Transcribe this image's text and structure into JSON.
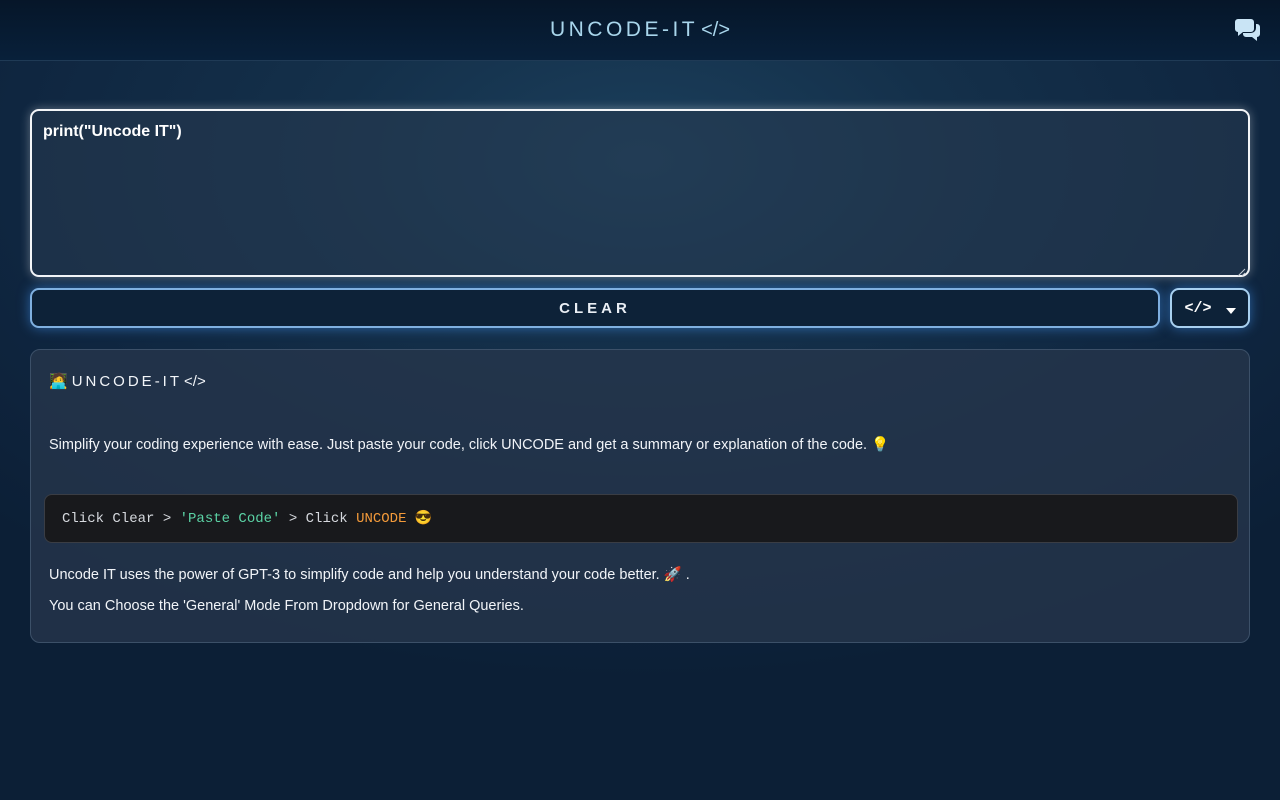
{
  "header": {
    "brand_text": "UNCODE-IT",
    "brand_tag": "</>",
    "chat_icon": "chat-bubbles-icon"
  },
  "editor": {
    "value": "print(\"Uncode IT\")"
  },
  "actions": {
    "clear_label": "CLEAR",
    "mode_label": "</>",
    "mode_icon": "chevron-down-icon"
  },
  "info": {
    "title_emoji": "🧑‍💻",
    "title_text": "UNCODE-IT",
    "title_tag": "</>",
    "description": "Simplify your coding experience with ease. Just paste your code, click UNCODE and get a summary or explanation of the code. 💡",
    "steps": {
      "part1": "Click Clear > ",
      "part2": "'Paste Code'",
      "part3": " > Click ",
      "part4": "UNCODE",
      "part5": " 😎"
    },
    "line1": "Uncode IT uses the power of GPT-3 to simplify code and help you understand your code better. 🚀 .",
    "line2": "You can Choose the 'General' Mode From Dropdown for General Queries."
  },
  "colors": {
    "accent_glow": "#7fb0e0",
    "string": "#5bd3a5",
    "keyword": "#f39a3a"
  }
}
